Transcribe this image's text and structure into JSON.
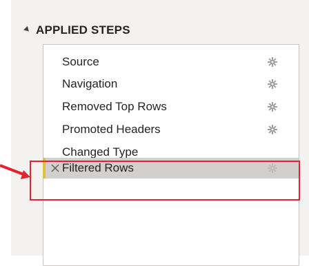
{
  "panel": {
    "section_title": "APPLIED STEPS"
  },
  "steps": [
    {
      "label": "Source",
      "has_gear": true
    },
    {
      "label": "Navigation",
      "has_gear": true
    },
    {
      "label": "Removed Top Rows",
      "has_gear": true
    },
    {
      "label": "Promoted Headers",
      "has_gear": true
    },
    {
      "label": "Changed Type",
      "has_gear": false
    },
    {
      "label": "Filtered Rows",
      "has_gear": true,
      "selected": true
    }
  ],
  "colors": {
    "selected_row": "#d2d0ce",
    "selection_marker": "#e3c03b",
    "highlight": "#e3232d"
  },
  "icons": {
    "collapse": "collapse-triangle-icon",
    "gear": "gear-icon",
    "delete": "delete-x-icon",
    "arrow": "red-arrow-icon"
  }
}
